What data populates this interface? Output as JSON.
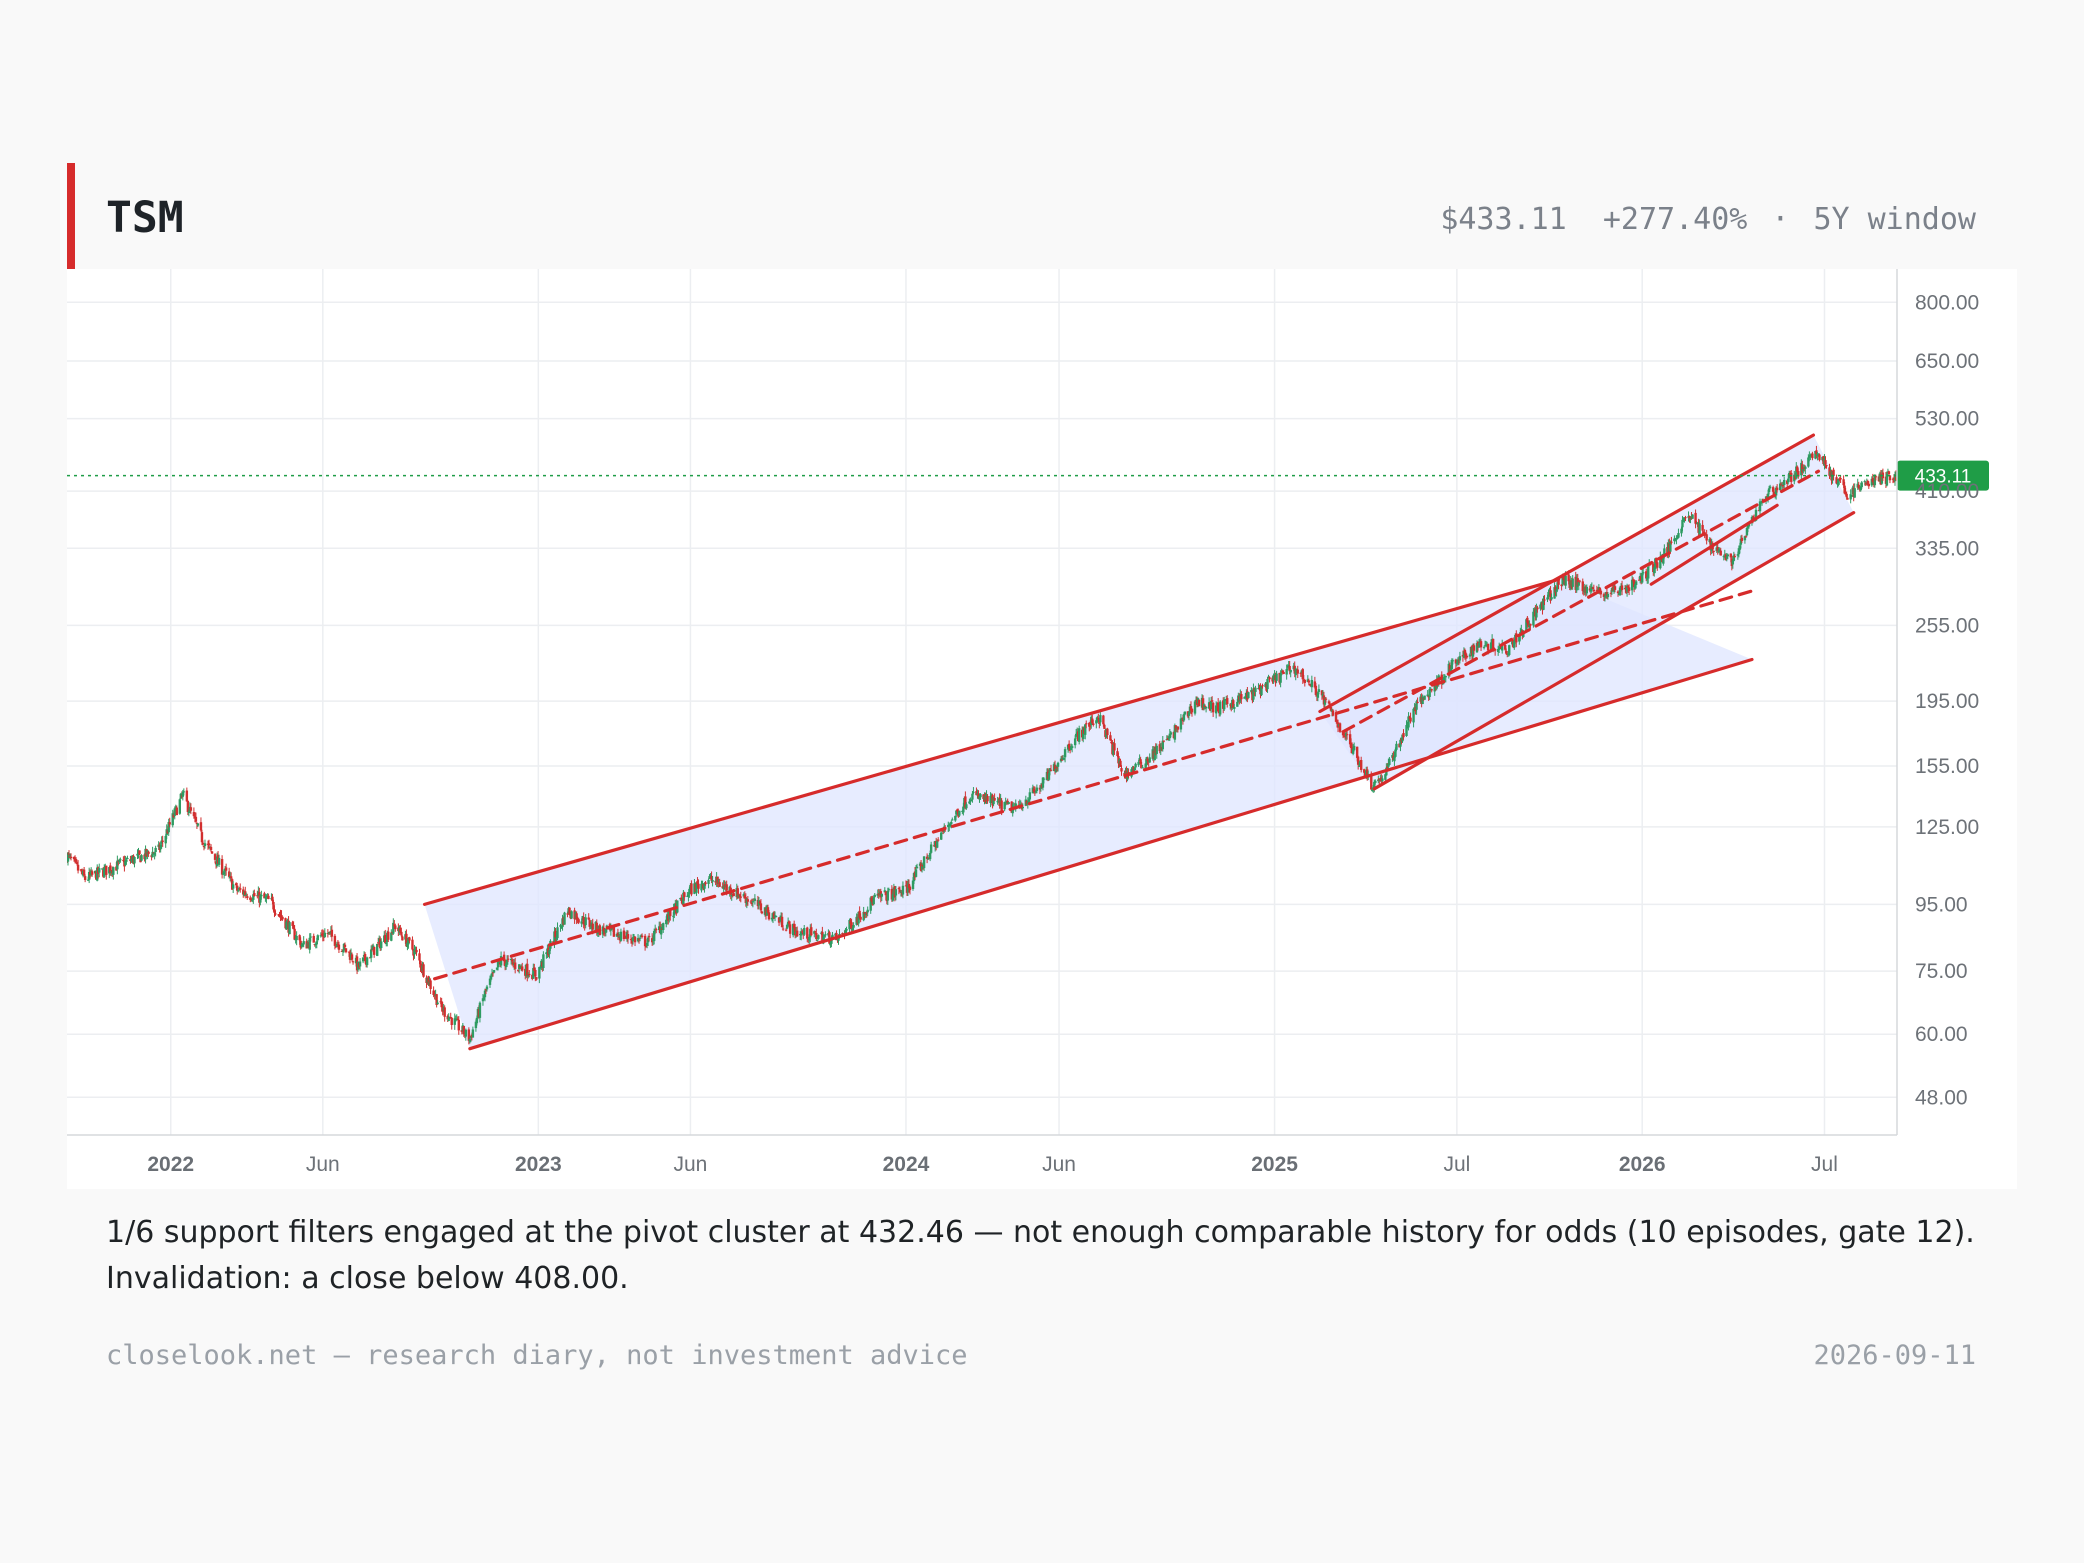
{
  "header": {
    "ticker": "TSM",
    "price": "$433.11",
    "change": "+277.40%",
    "separator": "·",
    "window": "5Y window"
  },
  "caption": {
    "line1": "1/6 support filters engaged at the pivot cluster at 432.46 — not enough comparable history for odds (10 episodes, gate 12).",
    "line2": "Invalidation: a close below 408.00."
  },
  "footer": {
    "left": "closelook.net — research diary, not investment advice",
    "right": "2026-09-11"
  },
  "colors": {
    "up": "#2e9b62",
    "down": "#d22f2f",
    "channel": "#d62b2b",
    "channel_fill": "#dfe6ff",
    "last_price": "#1f9d47",
    "grid": "#eceef1"
  },
  "chart_data": {
    "type": "candlestick",
    "scale": "log",
    "ylim": [
      42,
      900
    ],
    "y_ticks": [
      48,
      60,
      75,
      95,
      125,
      155,
      195,
      255,
      335,
      410,
      530,
      650,
      800
    ],
    "y_tick_labels": [
      "48.00",
      "60.00",
      "75.00",
      "95.00",
      "125.00",
      "155.00",
      "195.00",
      "255.00",
      "335.00",
      "410.00",
      "530.00",
      "650.00",
      "800.00"
    ],
    "x_range": [
      "2021-09-20",
      "2026-09-11"
    ],
    "x_ticks": [
      {
        "date": "2022-01-01",
        "label": "2022",
        "major": true
      },
      {
        "date": "2022-06-01",
        "label": "Jun",
        "major": false
      },
      {
        "date": "2023-01-01",
        "label": "2023",
        "major": true
      },
      {
        "date": "2023-06-01",
        "label": "Jun",
        "major": false
      },
      {
        "date": "2024-01-01",
        "label": "2024",
        "major": true
      },
      {
        "date": "2024-06-01",
        "label": "Jun",
        "major": false
      },
      {
        "date": "2025-01-01",
        "label": "2025",
        "major": true
      },
      {
        "date": "2025-07-01",
        "label": "Jul",
        "major": false
      },
      {
        "date": "2026-01-01",
        "label": "2026",
        "major": true
      },
      {
        "date": "2026-07-01",
        "label": "Jul",
        "major": false
      }
    ],
    "price_path": [
      [
        "2021-09-20",
        113
      ],
      [
        "2021-10-08",
        104
      ],
      [
        "2021-11-15",
        110
      ],
      [
        "2021-12-20",
        115
      ],
      [
        "2022-01-13",
        140
      ],
      [
        "2022-02-01",
        120
      ],
      [
        "2022-03-07",
        100
      ],
      [
        "2022-04-10",
        96
      ],
      [
        "2022-05-12",
        82
      ],
      [
        "2022-06-05",
        86
      ],
      [
        "2022-06-30",
        79
      ],
      [
        "2022-07-06",
        76
      ],
      [
        "2022-08-12",
        88
      ],
      [
        "2022-09-01",
        80
      ],
      [
        "2022-09-26",
        66
      ],
      [
        "2022-10-25",
        59
      ],
      [
        "2022-11-10",
        70
      ],
      [
        "2022-11-25",
        78
      ],
      [
        "2022-12-15",
        76
      ],
      [
        "2022-12-30",
        74
      ],
      [
        "2023-01-30",
        93
      ],
      [
        "2023-03-01",
        87
      ],
      [
        "2023-04-20",
        83
      ],
      [
        "2023-06-01",
        100
      ],
      [
        "2023-06-20",
        104
      ],
      [
        "2023-08-01",
        96
      ],
      [
        "2023-09-15",
        86
      ],
      [
        "2023-10-25",
        84
      ],
      [
        "2023-12-01",
        97
      ],
      [
        "2024-01-01",
        100
      ],
      [
        "2024-01-10",
        105
      ],
      [
        "2024-02-10",
        125
      ],
      [
        "2024-03-05",
        140
      ],
      [
        "2024-04-19",
        133
      ],
      [
        "2024-05-15",
        145
      ],
      [
        "2024-06-15",
        170
      ],
      [
        "2024-07-10",
        185
      ],
      [
        "2024-08-05",
        150
      ],
      [
        "2024-08-30",
        160
      ],
      [
        "2024-09-20",
        172
      ],
      [
        "2024-10-15",
        195
      ],
      [
        "2024-11-05",
        190
      ],
      [
        "2024-12-10",
        200
      ],
      [
        "2025-01-20",
        220
      ],
      [
        "2025-02-15",
        200
      ],
      [
        "2025-03-10",
        175
      ],
      [
        "2025-04-08",
        145
      ],
      [
        "2025-04-20",
        150
      ],
      [
        "2025-05-20",
        190
      ],
      [
        "2025-06-25",
        220
      ],
      [
        "2025-07-25",
        240
      ],
      [
        "2025-08-20",
        235
      ],
      [
        "2025-09-20",
        270
      ],
      [
        "2025-10-15",
        300
      ],
      [
        "2025-11-10",
        290
      ],
      [
        "2025-11-25",
        285
      ],
      [
        "2025-12-25",
        295
      ],
      [
        "2026-01-25",
        330
      ],
      [
        "2026-02-15",
        380
      ],
      [
        "2026-03-10",
        340
      ],
      [
        "2026-04-01",
        320
      ],
      [
        "2026-05-01",
        400
      ],
      [
        "2026-06-05",
        440
      ],
      [
        "2026-06-25",
        470
      ],
      [
        "2026-07-10",
        430
      ],
      [
        "2026-07-25",
        405
      ],
      [
        "2026-08-15",
        425
      ],
      [
        "2026-09-11",
        433.11
      ]
    ],
    "last_price": 433.11,
    "last_price_label": "433.11",
    "channels": [
      {
        "upper": [
          [
            "2022-09-10",
            95
          ],
          [
            "2025-10-10",
            300
          ]
        ],
        "mid": [
          [
            "2022-09-20",
            73
          ],
          [
            "2026-04-20",
            288
          ]
        ],
        "lower": [
          [
            "2022-10-25",
            57
          ],
          [
            "2026-04-20",
            226
          ]
        ]
      },
      {
        "upper": [
          [
            "2025-02-15",
            188
          ],
          [
            "2026-06-20",
            500
          ]
        ],
        "mid": [
          [
            "2025-03-10",
            175
          ],
          [
            "2026-06-25",
            440
          ]
        ],
        "lower": [
          [
            "2025-04-10",
            143
          ],
          [
            "2026-07-30",
            380
          ]
        ]
      }
    ],
    "channel_extra": {
      "short_line": [
        [
          "2026-01-10",
          295
        ],
        [
          "2026-05-15",
          390
        ]
      ]
    }
  }
}
